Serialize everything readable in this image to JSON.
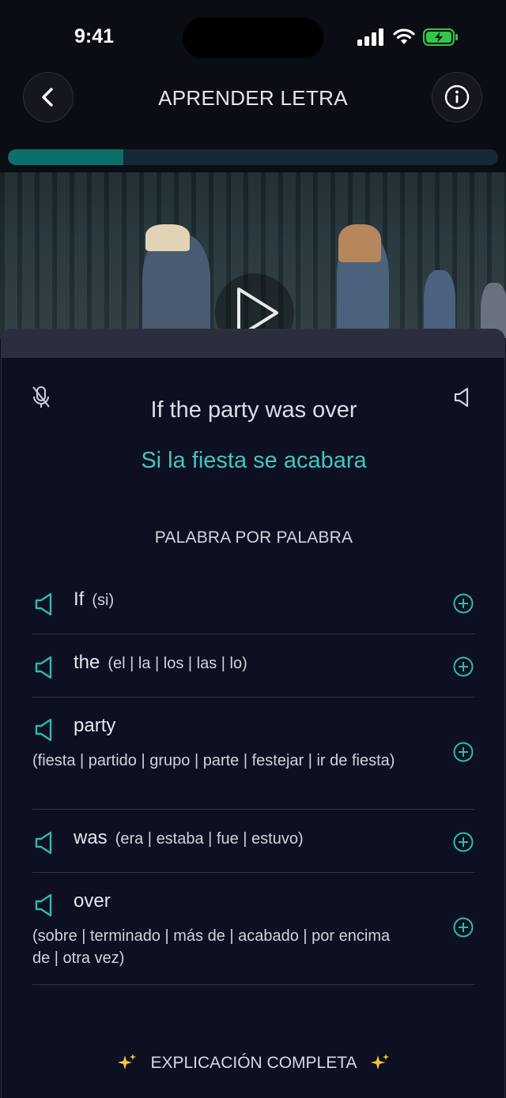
{
  "status_bar": {
    "time": "9:41"
  },
  "header": {
    "title": "APRENDER LETRA",
    "progress_fraction": 0.235
  },
  "colors": {
    "accent": "#3fc7c1",
    "progress": "#0c6f6a",
    "background": "#0b0f1c"
  },
  "lyric": {
    "original": "If the party was over",
    "translation": "Si la fiesta se acabara"
  },
  "word_by_word": {
    "title": "PALABRA POR PALABRA",
    "items": [
      {
        "word": "If",
        "meaning": "(si)"
      },
      {
        "word": "the",
        "meaning": "(el | la | los | las | lo)"
      },
      {
        "word": "party",
        "meaning": "(fiesta | partido | grupo | parte | festejar | ir de fiesta)"
      },
      {
        "word": "was",
        "meaning": "(era | estaba | fue | estuvo)"
      },
      {
        "word": "over",
        "meaning": "(sobre | terminado | más de | acabado | por encima de | otra vez)"
      }
    ]
  },
  "explain_button": {
    "label": "EXPLICACIÓN COMPLETA"
  },
  "icons": [
    "back-arrow-icon",
    "info-icon",
    "play-icon",
    "mic-off-icon",
    "speaker-icon",
    "add-circle-icon",
    "sparkle-icon"
  ]
}
